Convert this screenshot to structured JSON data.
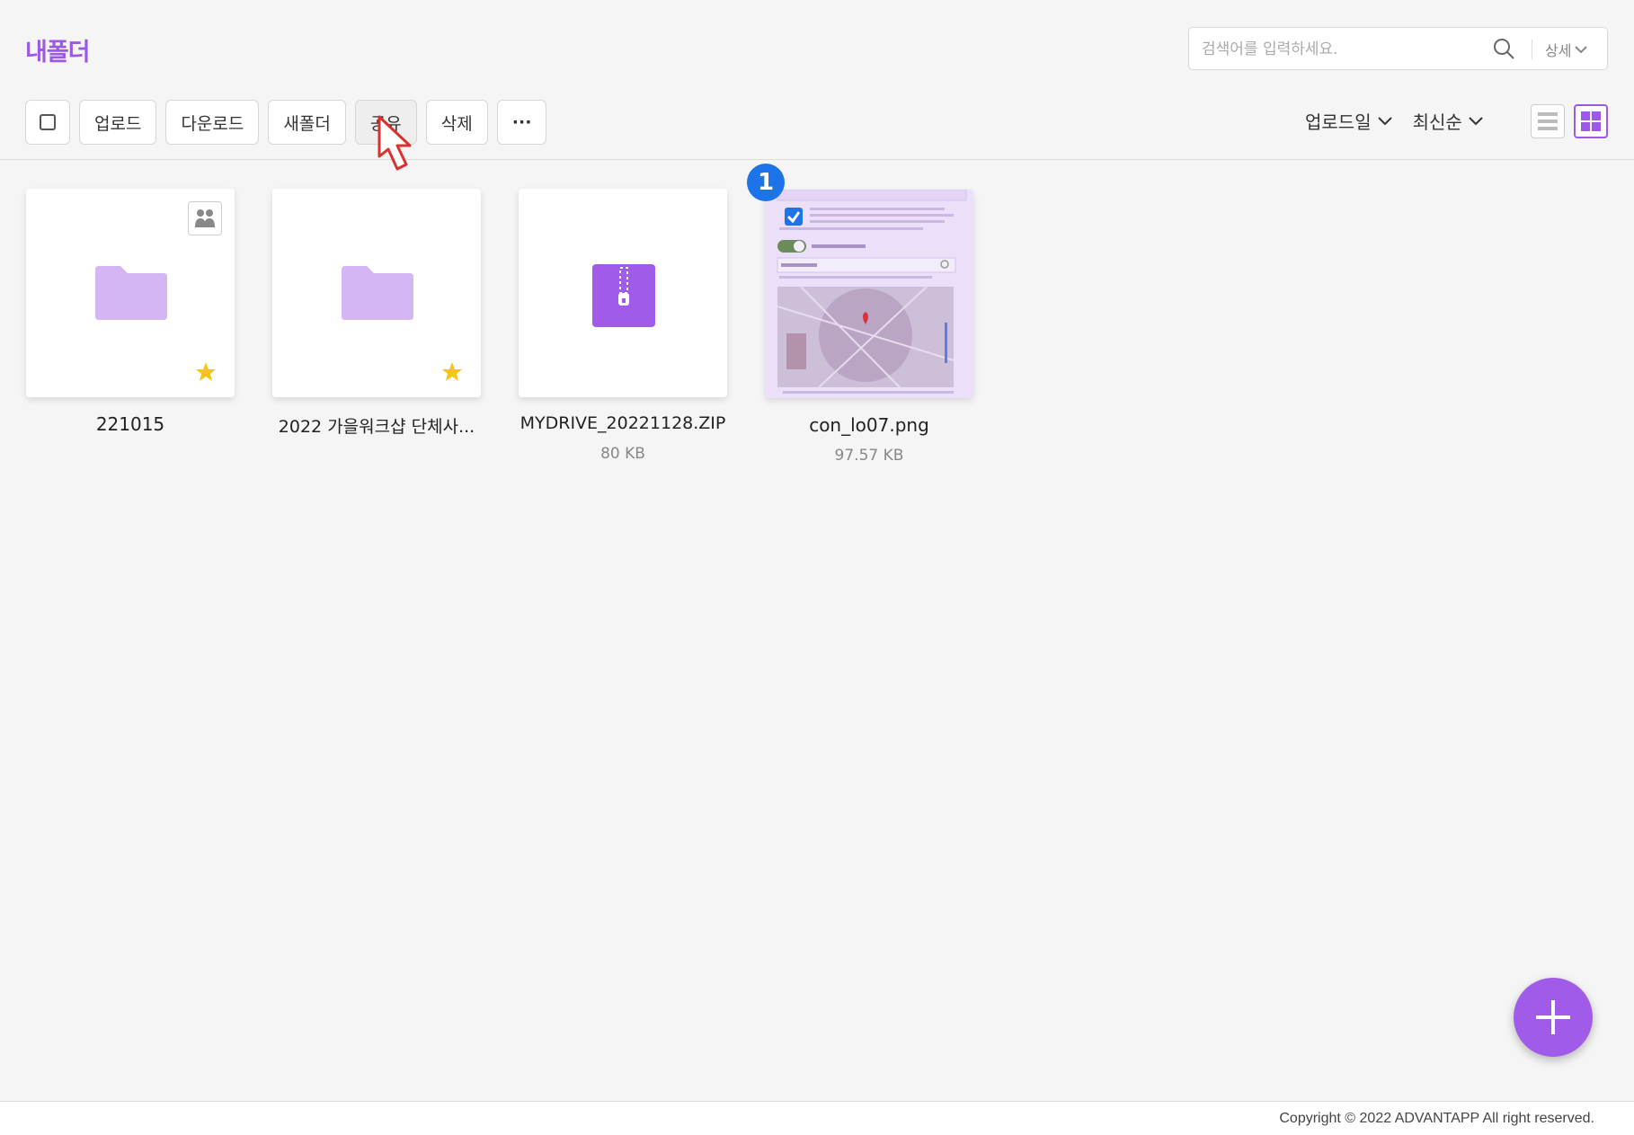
{
  "header": {
    "title": "내폴더",
    "search_placeholder": "검색어를 입력하세요.",
    "search_detail_label": "상세"
  },
  "toolbar": {
    "upload_label": "업로드",
    "download_label": "다운로드",
    "new_folder_label": "새폴더",
    "share_label": "공유",
    "delete_label": "삭제",
    "more_label": "···"
  },
  "sort": {
    "field_label": "업로드일",
    "order_label": "최신순"
  },
  "colors": {
    "accent": "#9b59e6",
    "folder": "#d5b6f5",
    "star": "#f5c518",
    "badge": "#1d73e8"
  },
  "files": [
    {
      "name": "221015",
      "type": "folder",
      "shared": true,
      "starred": true,
      "size": ""
    },
    {
      "name": "2022 가을워크샵 단체사...",
      "type": "folder",
      "shared": false,
      "starred": true,
      "size": ""
    },
    {
      "name": "MYDRIVE_20221128.ZIP",
      "type": "zip",
      "shared": false,
      "starred": false,
      "size": "80 KB"
    },
    {
      "name": "con_lo07.png",
      "type": "image",
      "shared": false,
      "starred": false,
      "size": "97.57 KB",
      "selected": true
    }
  ],
  "badge_number": "1",
  "footer": {
    "copyright": "Copyright © 2022 ADVANTAPP All right reserved."
  },
  "icons": [
    "search-icon",
    "chevron-down-icon",
    "share-people-icon",
    "star-icon",
    "folder-icon",
    "zip-icon",
    "list-view-icon",
    "grid-view-icon",
    "plus-icon",
    "cursor-arrow-icon"
  ]
}
